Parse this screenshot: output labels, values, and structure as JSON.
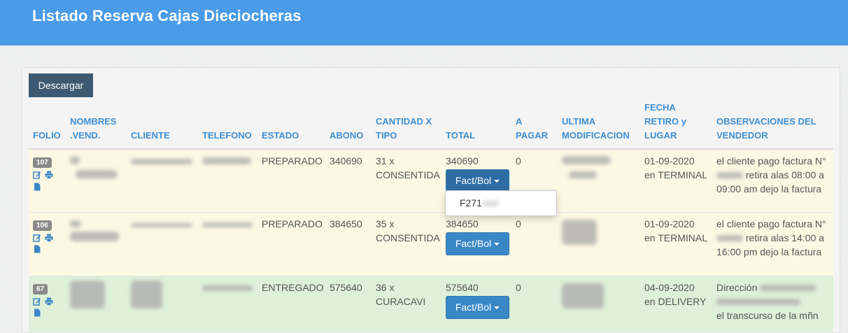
{
  "page": {
    "title": "Listado Reserva Cajas Dieciocheras"
  },
  "toolbar": {
    "download_label": "Descargar"
  },
  "table": {
    "headers": [
      "FOLIO",
      "NOMBRES .VEND.",
      "CLIENTE",
      "TELEFONO",
      "ESTADO",
      "ABONO",
      "CANTIDAD X TIPO",
      "TOTAL",
      "A PAGAR",
      "ULTIMA MODIFICACION",
      "FECHA RETIRO y LUGAR",
      "OBSERVACIONES DEL VENDEDOR"
    ],
    "rows": [
      {
        "folio": "107",
        "estado": "PREPARADO",
        "abono": "340690",
        "cantidad": "31 x CONSENTIDA",
        "total": "340690",
        "fact_label": "Fact/Bol",
        "a_pagar": "0",
        "fecha": "01-09-2020 en TERMINAL",
        "obs_1": "el cliente pago factura N°",
        "obs_2": " retira alas 08:00 a 09:00 am dejo la factura"
      },
      {
        "folio": "106",
        "estado": "PREPARADO",
        "abono": "384650",
        "cantidad": "35 x CONSENTIDA",
        "total": "384650",
        "fact_label": "Fact/Bol",
        "a_pagar": "0",
        "fecha": "01-09-2020 en TERMINAL",
        "obs_1": "el cliente pago factura N°",
        "obs_2": " retira alas 14:00 a 16:00 pm dejo la factura"
      },
      {
        "folio": "67",
        "estado": "ENTREGADO",
        "abono": "575640",
        "cantidad": "36 x CURACAVI",
        "total": "575640",
        "fact_label": "Fact/Bol",
        "a_pagar": "0",
        "fecha": "04-09-2020 en DELIVERY",
        "obs_1": "Dirección ",
        "obs_2": " el transcurso de la mñn"
      }
    ]
  },
  "dropdown": {
    "item_prefix": "F271"
  },
  "icons": {
    "edit": "edit-icon",
    "print": "print-icon",
    "document": "document-icon",
    "caret": "caret-down-icon"
  },
  "colors": {
    "header_bg": "#4a9be8",
    "header_text": "#ffffff",
    "th_text": "#3f8fd3",
    "btn_dark": "#3e5a72",
    "btn_blue": "#3a87c6",
    "row_yellow": "#fcf8e3",
    "row_green": "#dff0d8",
    "badge": "#8a8a8a"
  }
}
